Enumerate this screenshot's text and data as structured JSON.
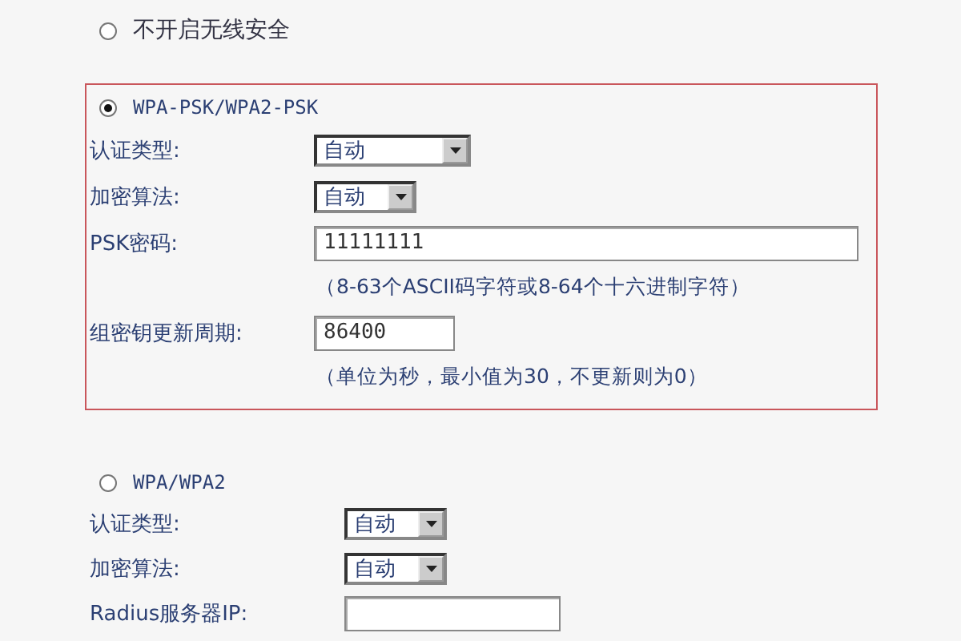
{
  "options": [
    {
      "label": "不开启无线安全",
      "selected": false,
      "highlighted": false
    },
    {
      "label": "WPA-PSK/WPA2-PSK",
      "selected": true,
      "highlighted": true,
      "fields": [
        {
          "kind": "wideselect",
          "label": "认证类型:",
          "value": "自动"
        },
        {
          "kind": "select",
          "label": "加密算法:",
          "value": "自动"
        },
        {
          "kind": "widetext",
          "label": "PSK密码:",
          "value": "11111111"
        },
        {
          "kind": "hint",
          "text": "（8-63个ASCII码字符或8-64个十六进制字符）"
        },
        {
          "kind": "text",
          "label": "组密钥更新周期:",
          "value": "86400"
        },
        {
          "kind": "hint",
          "text": "（单位为秒，最小值为30，不更新则为0）"
        }
      ]
    },
    {
      "label": "WPA/WPA2",
      "selected": false,
      "highlighted": false,
      "fields": [
        {
          "kind": "select",
          "label": "认证类型:",
          "value": "自动"
        },
        {
          "kind": "select",
          "label": "加密算法:",
          "value": "自动"
        },
        {
          "kind": "text",
          "label": "Radius服务器IP:"
        }
      ]
    }
  ]
}
